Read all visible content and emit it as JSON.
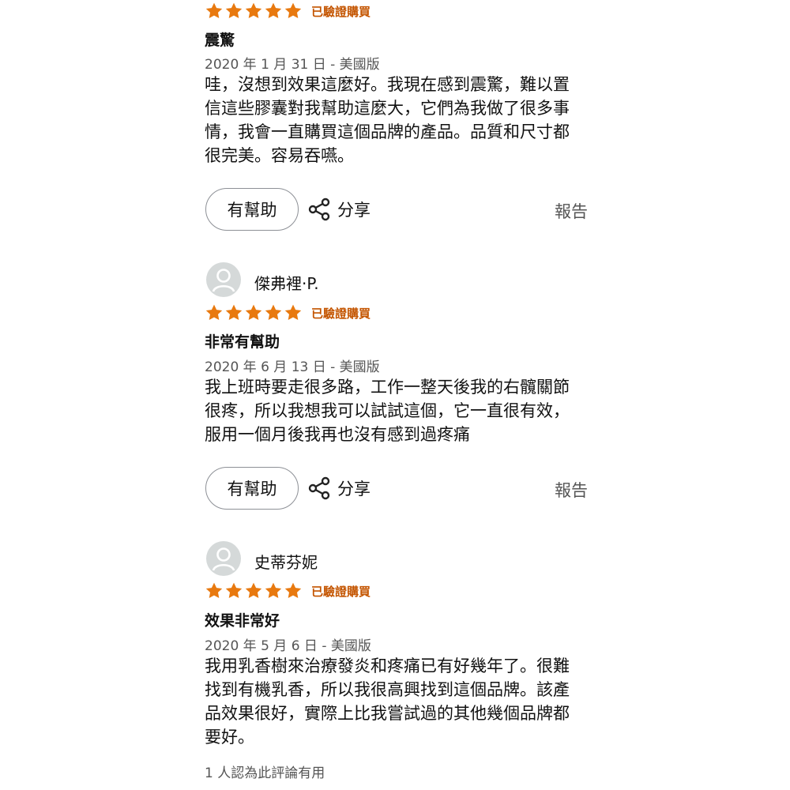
{
  "colors": {
    "star": "#e8790f",
    "verified": "#c45500",
    "avatar_bg": "#d5d9d9",
    "avatar_fg": "#ffffff"
  },
  "icons": {
    "star": "star-icon",
    "share": "share-icon",
    "avatar": "person-icon"
  },
  "reviews": [
    {
      "rating": 5,
      "badge": "已驗證購買",
      "title": "震驚",
      "date": "2020 年 1 月 31 日 - 美國版",
      "body_lines": [
        "哇，沒想到效果這麼好。我現在感到震驚，難以置",
        "信這些膠囊對我幫助這麼大，它們為我做了很多事",
        "情，我會一直購買這個品牌的產品。品質和尺寸都",
        "很完美。容易吞嚥。"
      ],
      "helpful_label": "有幫助",
      "share_label": "分享",
      "report_label": "報告"
    },
    {
      "reviewer": "傑弗裡·P.",
      "rating": 5,
      "badge": "已驗證購買",
      "title": "非常有幫助",
      "date": "2020 年 6 月 13 日 - 美國版",
      "body_lines": [
        "我上班時要走很多路，工作一整天後我的右髖關節",
        "很疼，所以我想我可以試試這個，它一直很有效，",
        "服用一個月後我再也沒有感到過疼痛"
      ],
      "helpful_label": "有幫助",
      "share_label": "分享",
      "report_label": "報告"
    },
    {
      "reviewer": "史蒂芬妮",
      "rating": 5,
      "badge": "已驗證購買",
      "title": "效果非常好",
      "date": "2020 年 5 月 6 日 - 美國版",
      "body_lines": [
        "我用乳香樹來治療發炎和疼痛已有好幾年了。很難",
        "找到有機乳香，所以我很高興找到這個品牌。該產",
        "品效果很好，實際上比我嘗試過的其他幾個品牌都",
        "要好。"
      ],
      "helpful_count": "1 人認為此評論有用"
    }
  ]
}
